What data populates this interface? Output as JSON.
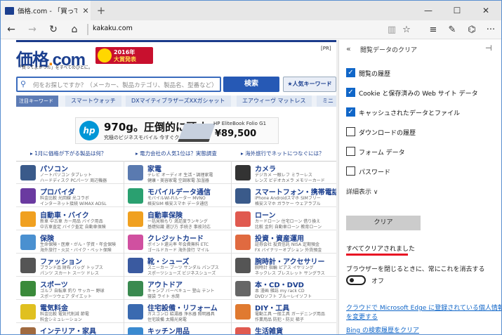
{
  "tab": {
    "title": "価格.com - 「買ってよかっ"
  },
  "address": {
    "url": "kakaku.com"
  },
  "site": {
    "logo_main": "価格",
    "logo_dot": ".",
    "logo_com": "com",
    "tagline": "「買ってよかった」をすべてのひとに。",
    "award_line1": "2016年",
    "award_line2": "大賞発表",
    "pr": "[PR]",
    "search_placeholder": "何をお探しですか？（メーカー、製品カテゴリ、製品名、型番など）",
    "search_button": "検索",
    "popular_button": "★人気キーワード",
    "keyword_label": "注目キーワード",
    "keywords": [
      "スマートウォッチ",
      "DXマイティブラザーズXXガシャット",
      "エアウィーヴ マットレス",
      "ミニ"
    ],
    "ad": {
      "brand": "hp",
      "headline": "970g。圧倒的に頑丈。",
      "sub": "究極のビジネスモバイル 今すぐクリック",
      "model": "HP EliteBook Folio G1",
      "price": "¥89,500"
    },
    "infos": [
      "▸ 1月に価格が下がる製品は何？",
      "▸ 電力会社の人気1位は？実態調査",
      "▸ 海外旅行でネットにつなぐには？"
    ],
    "categories": [
      {
        "name": "パソコン",
        "d1": "ノートパソコン タブレット",
        "d2": "ハードディスク PCパーツ 周辺機器",
        "color": "#3a5a8a"
      },
      {
        "name": "家電",
        "d1": "テレビ オーディオ 生活・調理家電",
        "d2": "健康・美容家電 空調家電 加湿器",
        "color": "#5a7ab0"
      },
      {
        "name": "カメラ",
        "d1": "デジカメ 一眼レフ ミラーレス",
        "d2": "レンズ ビデオカメラ メモリーカード",
        "color": "#333333"
      },
      {
        "name": "プロバイダ",
        "d1": "料金比較 光回線 光コラボ",
        "d2": "インターネット接続 WiMAX ADSL",
        "color": "#6a3aa0"
      },
      {
        "name": "モバイルデータ通信",
        "d1": "モバイルWi-Fiルーター MVNO",
        "d2": "格安SIM 格安スマホ データ通信",
        "color": "#2aa070"
      },
      {
        "name": "スマートフォン・携帯電話",
        "d1": "iPhone Androidスマホ SIMフリー",
        "d2": "格安スマホ ガラケー ウェアラブル",
        "color": "#3a5a8a"
      },
      {
        "name": "自動車・バイク",
        "d1": "新車 中古車 カー用品 バイク用品",
        "d2": "中古車査定 バイク査定 自動車保険",
        "color": "#f0a020"
      },
      {
        "name": "自動車保険",
        "d1": "一括見積もり 満足度ランキング",
        "d2": "基礎知識 選び方 手続き 事故対応",
        "color": "#f0a020"
      },
      {
        "name": "ローン",
        "d1": "カードローン 住宅ローン 借り換え",
        "d2": "比較 金利 自動車ローン 教育ローン",
        "color": "#e05a50"
      },
      {
        "name": "保険",
        "d1": "生命保険・医療・がん・学資・年金保険",
        "d2": "海外旅行・火災・バイク・ペット保険",
        "color": "#4a90d0"
      },
      {
        "name": "クレジットカード",
        "d1": "ポイント還元率 年会費無料 ETC",
        "d2": "ゴールドカード 海外旅行 マイル",
        "color": "#d050a0"
      },
      {
        "name": "投資・資産運用",
        "d1": "証券会社 投資信託 NISA 定期預金",
        "d2": "FX バイナリーオプション 外貨預金",
        "color": "#e06a40"
      },
      {
        "name": "ファッション",
        "d1": "ブランド品 財布 バッグ トップス",
        "d2": "パンツ スカート スーツ ドレス",
        "color": "#555555"
      },
      {
        "name": "靴・シューズ",
        "d1": "スニーカー ブーツ サンダル パンプス",
        "d2": "スポーツシューズ ビジネスシューズ",
        "color": "#3a5aa0"
      },
      {
        "name": "腕時計・アクセサリー",
        "d1": "腕時計 指輪 ピアス イヤリング",
        "d2": "ネックレス ブレスレット サングラス",
        "color": "#555555"
      },
      {
        "name": "スポーツ",
        "d1": "ゴルフ 自転車 釣り サッカー 野球",
        "d2": "スポーツウェア ダイエット",
        "color": "#3a8a3a"
      },
      {
        "name": "アウトドア",
        "d1": "キャンプ バーベキュー 登山 テント",
        "d2": "寝袋 ライト 水筒",
        "color": "#3a8a50"
      },
      {
        "name": "本・CD・DVD",
        "d1": "本 漫画 雑誌 my rack CD",
        "d2": "DVDソフト ブルーレイソフト",
        "color": "#666666"
      },
      {
        "name": "電気料金",
        "d1": "料金比較 電気代削減 節電",
        "d2": "料金シミュレーション",
        "color": "#e0c020"
      },
      {
        "name": "住宅設備・リフォーム",
        "d1": "ガスコンロ 給湯器 浄水器 照明器具",
        "d2": "住宅設備 太陽光発電",
        "color": "#3a6ab0"
      },
      {
        "name": "DIY・工具",
        "d1": "電動工具 一般工具 ガーデニング用品",
        "d2": "作業用品 防犯・防災 梯子",
        "color": "#e07a30"
      },
      {
        "name": "インテリア・家具",
        "d1": "",
        "d2": "",
        "color": "#a06a40"
      },
      {
        "name": "キッチン用品",
        "d1": "",
        "d2": "",
        "color": "#3a8ad0"
      },
      {
        "name": "生活雑貨",
        "d1": "",
        "d2": "",
        "color": "#e05a50"
      }
    ]
  },
  "panel": {
    "title": "閲覧データのクリア",
    "options": [
      {
        "label": "閲覧の履歴",
        "checked": true
      },
      {
        "label": "Cookie と保存済みの Web サイト データ",
        "checked": true
      },
      {
        "label": "キャッシュされたデータとファイル",
        "checked": true
      },
      {
        "label": "ダウンロードの履歴",
        "checked": false
      },
      {
        "label": "フォーム データ",
        "checked": false
      },
      {
        "label": "パスワード",
        "checked": false
      }
    ],
    "more": "詳細表示 ∨",
    "clear_button": "クリア",
    "cleared_text": "すべてクリアされました",
    "close_note": "ブラウザーを閉じるときに、常にこれを消去する",
    "toggle_label": "オフ",
    "link1": "クラウドで Microsoft Edge に登録されている個人情報",
    "link1b": "を変更する",
    "link2": "Bing の検索履歴をクリア"
  }
}
